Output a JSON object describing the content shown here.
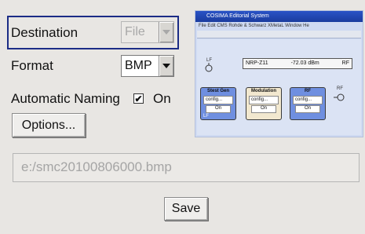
{
  "destination": {
    "label": "Destination",
    "value": "File"
  },
  "format": {
    "label": "Format",
    "value": "BMP"
  },
  "automatic_naming": {
    "label": "Automatic Naming",
    "checked": true,
    "state": "On"
  },
  "options_button": {
    "label": "Options..."
  },
  "file_path": {
    "value": "e:/smc20100806000.bmp"
  },
  "save_button": {
    "label": "Save"
  },
  "preview": {
    "title": "COSIMA Editorial System",
    "menu": "File  Edit  CMS  Rohde & Schwarz  XMetaL  Window  He",
    "readout_device": "NRP-Z11",
    "readout_value": "-72.03 dBm",
    "readout_unit": "RF",
    "lf_label": "LF",
    "rf_label": "RF",
    "blocks": [
      {
        "title": "Stest Gen",
        "config": "config...",
        "on": "On",
        "footer": "LF"
      },
      {
        "title": "Modulation",
        "config": "config...",
        "on": "On"
      },
      {
        "title": "RF",
        "config": "config...",
        "on": "On"
      }
    ]
  },
  "colors": {
    "background": "#e8e6e3",
    "focus_frame": "#1b2c86",
    "disabled_text": "#a8a8a8"
  }
}
